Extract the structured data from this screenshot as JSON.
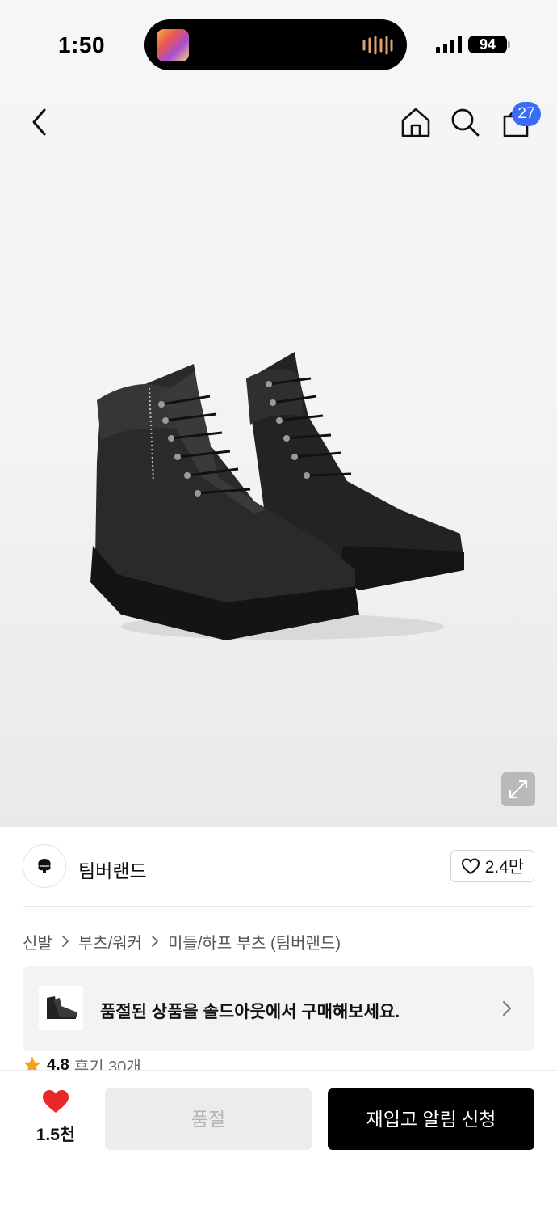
{
  "status_bar": {
    "time": "1:50",
    "battery": "94"
  },
  "header": {
    "cart_count": "27"
  },
  "brand": {
    "name": "팀버랜드",
    "likes": "2.4만"
  },
  "breadcrumb": [
    "신발",
    "부츠/워커",
    "미들/하프 부츠 (팀버랜드)"
  ],
  "banner": {
    "text": "품절된 상품을 솔드아웃에서 구매해보세요."
  },
  "review": {
    "rating": "4.8",
    "label": "후기 30개"
  },
  "bottom": {
    "wish_count": "1.5천",
    "soldout_label": "품절",
    "restock_label": "재입고 알림 신청"
  },
  "colors": {
    "accent": "#3b6cf6",
    "heart": "#e8282b",
    "star": "#f7a21b"
  },
  "icons": [
    "back-icon",
    "home-icon",
    "search-icon",
    "shopping-bag-icon",
    "expand-icon",
    "heart-outline-icon",
    "chevron-right-icon",
    "star-icon",
    "heart-filled-icon"
  ]
}
